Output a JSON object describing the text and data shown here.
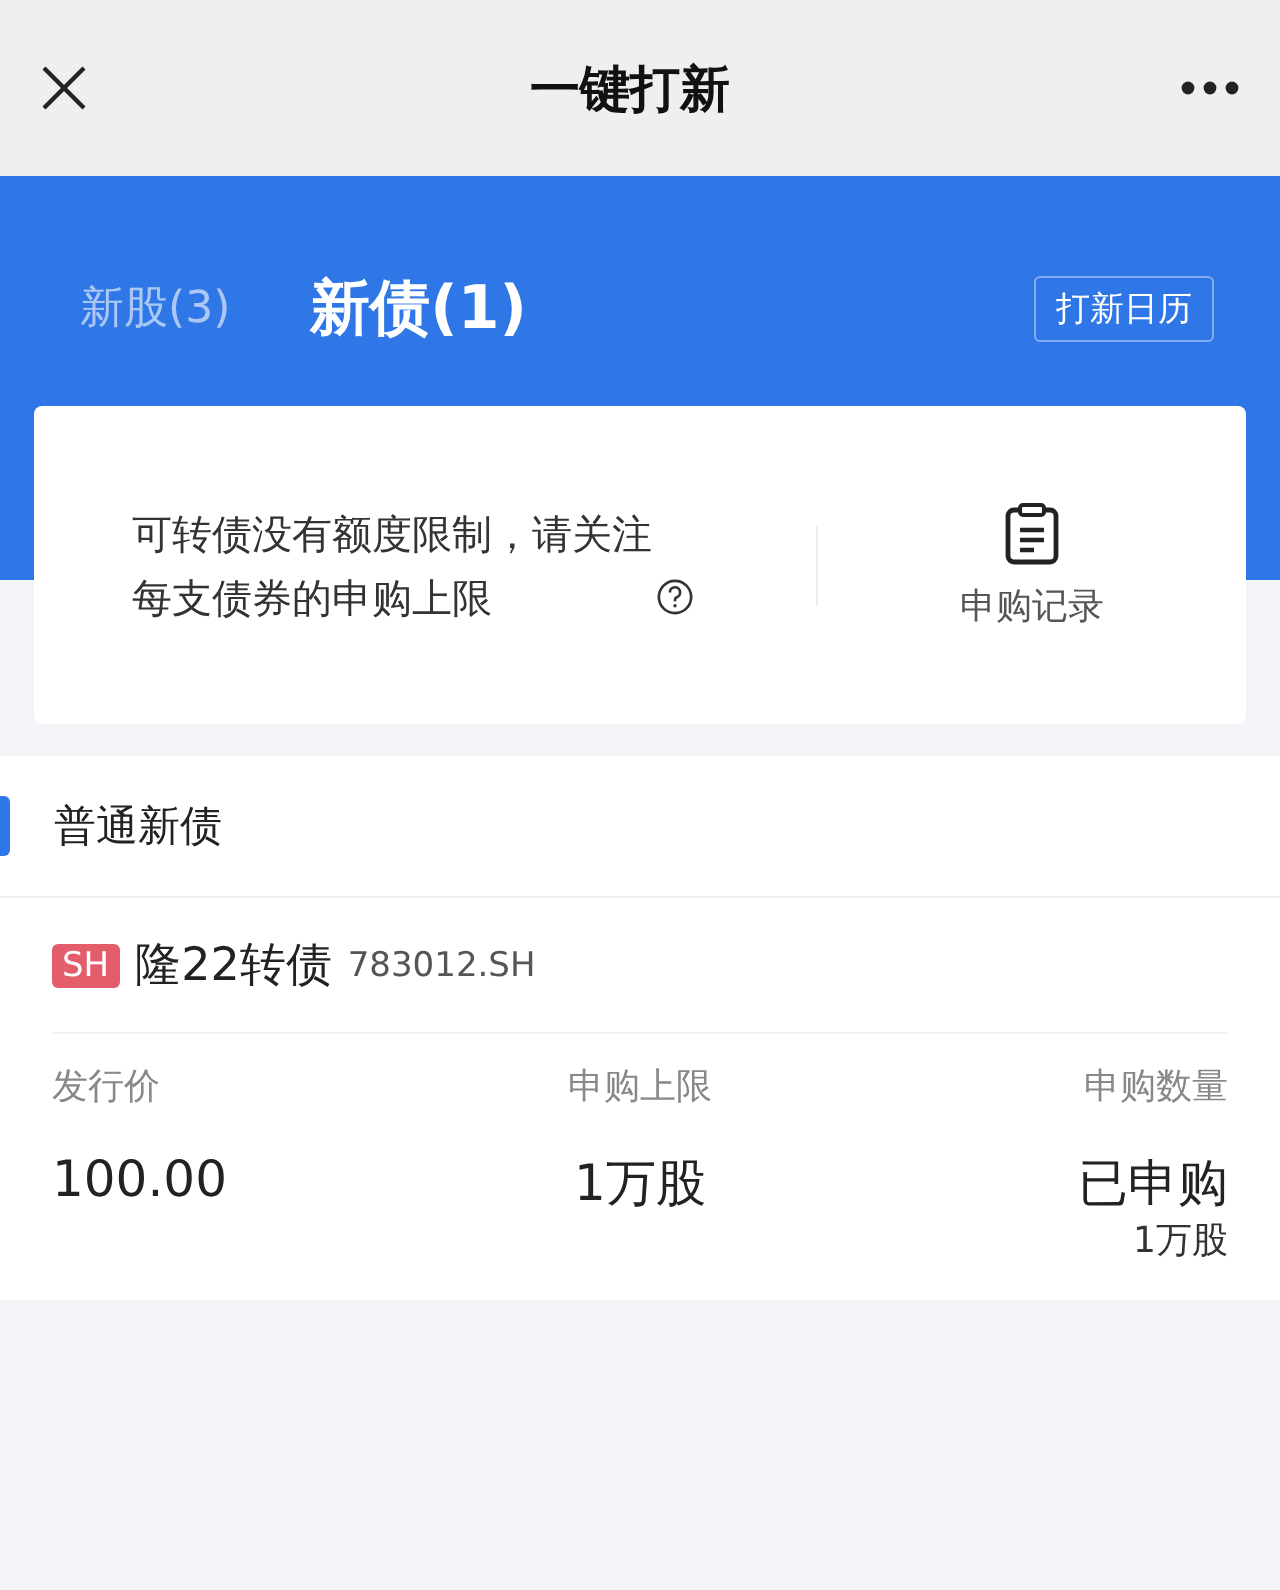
{
  "nav": {
    "title": "一键打新"
  },
  "tabs": [
    {
      "label": "新股(3)",
      "selected": false
    },
    {
      "label": "新债(1)",
      "selected": true
    }
  ],
  "calendar_button": "打新日历",
  "notice": {
    "text": "可转债没有额度限制，请关注每支债券的申购上限"
  },
  "records_button": "申购记录",
  "section": {
    "title": "普通新债"
  },
  "bonds": [
    {
      "exchange": "SH",
      "name": "隆22转债",
      "code": "783012.SH",
      "fields": [
        {
          "label": "发行价",
          "value": "100.00"
        },
        {
          "label": "申购上限",
          "value": "1万股"
        },
        {
          "label": "申购数量",
          "value": "已申购",
          "sub": "1万股"
        }
      ]
    }
  ]
}
